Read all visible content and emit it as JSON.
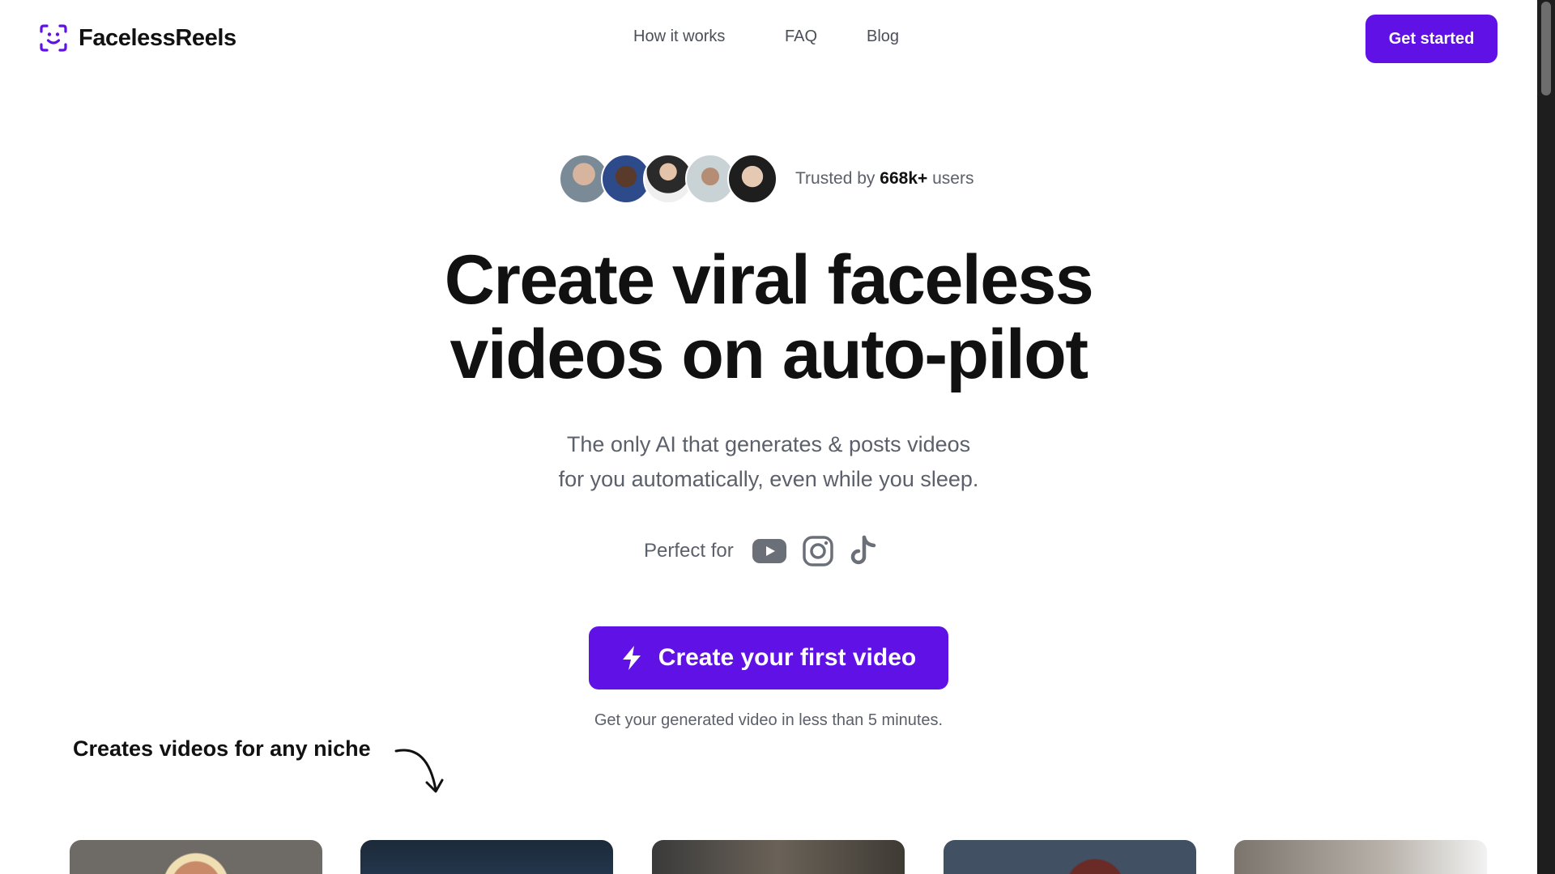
{
  "brand": {
    "name": "FacelessReels",
    "accent": "#6011e6"
  },
  "nav": {
    "links": [
      {
        "label": "How it works"
      },
      {
        "label": "FAQ"
      },
      {
        "label": "Blog"
      }
    ],
    "cta_label": "Get started"
  },
  "trust": {
    "prefix": "Trusted by",
    "count": "668k+",
    "suffix": "users",
    "avatars": [
      "avatar-1",
      "avatar-2",
      "avatar-3",
      "avatar-4",
      "avatar-5"
    ]
  },
  "hero": {
    "headline_line1": "Create viral faceless",
    "headline_line2": "videos on auto-pilot",
    "subtitle_line1": "The only AI that generates & posts videos",
    "subtitle_line2": "for you automatically, even while you sleep."
  },
  "platforms": {
    "label": "Perfect for",
    "icons": [
      "youtube-icon",
      "instagram-icon",
      "tiktok-icon"
    ]
  },
  "cta": {
    "label": "Create your first video",
    "icon": "lightning-icon",
    "note": "Get your generated video in less than 5 minutes."
  },
  "niches": {
    "label": "Creates videos for any niche",
    "icon": "curved-arrow-icon"
  }
}
